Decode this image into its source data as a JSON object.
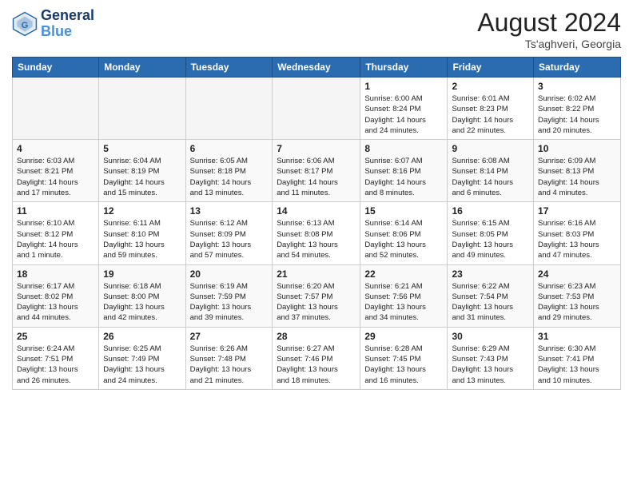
{
  "header": {
    "logo_line1": "General",
    "logo_line2": "Blue",
    "month_year": "August 2024",
    "location": "Ts'aghveri, Georgia"
  },
  "days_of_week": [
    "Sunday",
    "Monday",
    "Tuesday",
    "Wednesday",
    "Thursday",
    "Friday",
    "Saturday"
  ],
  "weeks": [
    [
      {
        "day": "",
        "info": ""
      },
      {
        "day": "",
        "info": ""
      },
      {
        "day": "",
        "info": ""
      },
      {
        "day": "",
        "info": ""
      },
      {
        "day": "1",
        "info": "Sunrise: 6:00 AM\nSunset: 8:24 PM\nDaylight: 14 hours\nand 24 minutes."
      },
      {
        "day": "2",
        "info": "Sunrise: 6:01 AM\nSunset: 8:23 PM\nDaylight: 14 hours\nand 22 minutes."
      },
      {
        "day": "3",
        "info": "Sunrise: 6:02 AM\nSunset: 8:22 PM\nDaylight: 14 hours\nand 20 minutes."
      }
    ],
    [
      {
        "day": "4",
        "info": "Sunrise: 6:03 AM\nSunset: 8:21 PM\nDaylight: 14 hours\nand 17 minutes."
      },
      {
        "day": "5",
        "info": "Sunrise: 6:04 AM\nSunset: 8:19 PM\nDaylight: 14 hours\nand 15 minutes."
      },
      {
        "day": "6",
        "info": "Sunrise: 6:05 AM\nSunset: 8:18 PM\nDaylight: 14 hours\nand 13 minutes."
      },
      {
        "day": "7",
        "info": "Sunrise: 6:06 AM\nSunset: 8:17 PM\nDaylight: 14 hours\nand 11 minutes."
      },
      {
        "day": "8",
        "info": "Sunrise: 6:07 AM\nSunset: 8:16 PM\nDaylight: 14 hours\nand 8 minutes."
      },
      {
        "day": "9",
        "info": "Sunrise: 6:08 AM\nSunset: 8:14 PM\nDaylight: 14 hours\nand 6 minutes."
      },
      {
        "day": "10",
        "info": "Sunrise: 6:09 AM\nSunset: 8:13 PM\nDaylight: 14 hours\nand 4 minutes."
      }
    ],
    [
      {
        "day": "11",
        "info": "Sunrise: 6:10 AM\nSunset: 8:12 PM\nDaylight: 14 hours\nand 1 minute."
      },
      {
        "day": "12",
        "info": "Sunrise: 6:11 AM\nSunset: 8:10 PM\nDaylight: 13 hours\nand 59 minutes."
      },
      {
        "day": "13",
        "info": "Sunrise: 6:12 AM\nSunset: 8:09 PM\nDaylight: 13 hours\nand 57 minutes."
      },
      {
        "day": "14",
        "info": "Sunrise: 6:13 AM\nSunset: 8:08 PM\nDaylight: 13 hours\nand 54 minutes."
      },
      {
        "day": "15",
        "info": "Sunrise: 6:14 AM\nSunset: 8:06 PM\nDaylight: 13 hours\nand 52 minutes."
      },
      {
        "day": "16",
        "info": "Sunrise: 6:15 AM\nSunset: 8:05 PM\nDaylight: 13 hours\nand 49 minutes."
      },
      {
        "day": "17",
        "info": "Sunrise: 6:16 AM\nSunset: 8:03 PM\nDaylight: 13 hours\nand 47 minutes."
      }
    ],
    [
      {
        "day": "18",
        "info": "Sunrise: 6:17 AM\nSunset: 8:02 PM\nDaylight: 13 hours\nand 44 minutes."
      },
      {
        "day": "19",
        "info": "Sunrise: 6:18 AM\nSunset: 8:00 PM\nDaylight: 13 hours\nand 42 minutes."
      },
      {
        "day": "20",
        "info": "Sunrise: 6:19 AM\nSunset: 7:59 PM\nDaylight: 13 hours\nand 39 minutes."
      },
      {
        "day": "21",
        "info": "Sunrise: 6:20 AM\nSunset: 7:57 PM\nDaylight: 13 hours\nand 37 minutes."
      },
      {
        "day": "22",
        "info": "Sunrise: 6:21 AM\nSunset: 7:56 PM\nDaylight: 13 hours\nand 34 minutes."
      },
      {
        "day": "23",
        "info": "Sunrise: 6:22 AM\nSunset: 7:54 PM\nDaylight: 13 hours\nand 31 minutes."
      },
      {
        "day": "24",
        "info": "Sunrise: 6:23 AM\nSunset: 7:53 PM\nDaylight: 13 hours\nand 29 minutes."
      }
    ],
    [
      {
        "day": "25",
        "info": "Sunrise: 6:24 AM\nSunset: 7:51 PM\nDaylight: 13 hours\nand 26 minutes."
      },
      {
        "day": "26",
        "info": "Sunrise: 6:25 AM\nSunset: 7:49 PM\nDaylight: 13 hours\nand 24 minutes."
      },
      {
        "day": "27",
        "info": "Sunrise: 6:26 AM\nSunset: 7:48 PM\nDaylight: 13 hours\nand 21 minutes."
      },
      {
        "day": "28",
        "info": "Sunrise: 6:27 AM\nSunset: 7:46 PM\nDaylight: 13 hours\nand 18 minutes."
      },
      {
        "day": "29",
        "info": "Sunrise: 6:28 AM\nSunset: 7:45 PM\nDaylight: 13 hours\nand 16 minutes."
      },
      {
        "day": "30",
        "info": "Sunrise: 6:29 AM\nSunset: 7:43 PM\nDaylight: 13 hours\nand 13 minutes."
      },
      {
        "day": "31",
        "info": "Sunrise: 6:30 AM\nSunset: 7:41 PM\nDaylight: 13 hours\nand 10 minutes."
      }
    ]
  ]
}
